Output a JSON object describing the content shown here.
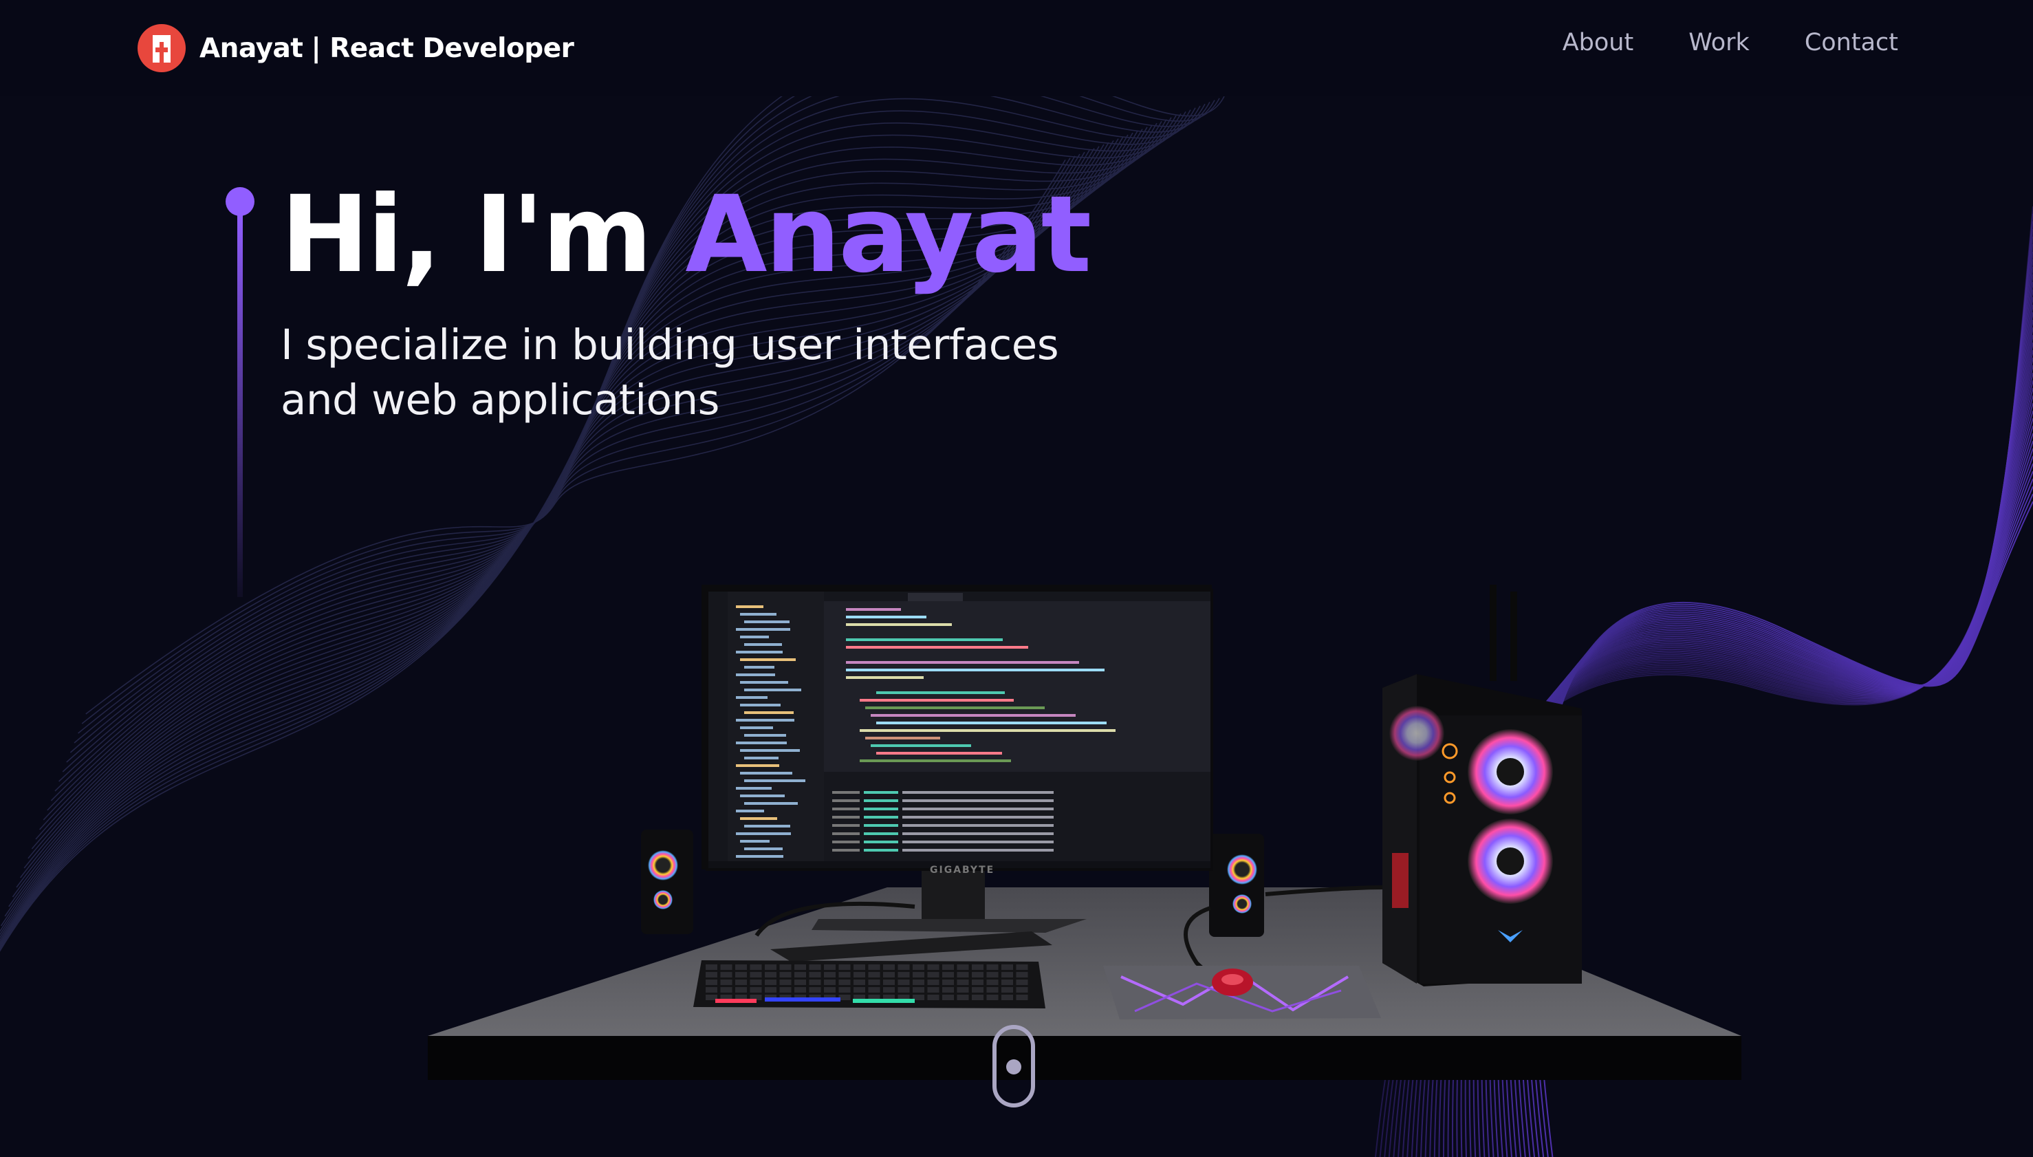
{
  "navbar": {
    "logo_name": "Anayat",
    "logo_suffix": "| React Developer",
    "links": [
      "About",
      "Work",
      "Contact"
    ]
  },
  "hero": {
    "greeting": "Hi, I'm ",
    "name": "Anayat",
    "subtitle": "I specialize in building user interfaces and web applications"
  },
  "scene": {
    "monitor_brand": "GIGABYTE"
  },
  "colors": {
    "background": "#080917",
    "accent": "#915eff",
    "logo_badge": "#e8473d"
  }
}
